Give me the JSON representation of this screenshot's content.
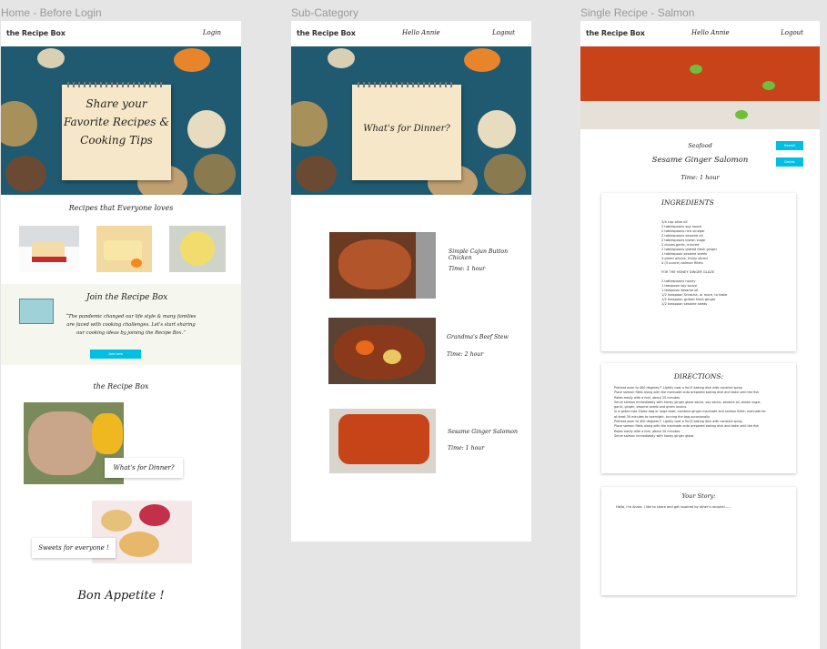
{
  "frames": {
    "home": {
      "title": "Home - Before Login"
    },
    "sub": {
      "title": "Sub-Category"
    },
    "single": {
      "title": "Single Recipe - Salmon"
    }
  },
  "home": {
    "logo": "the Recipe Box",
    "login": "Login",
    "hero_lines": [
      "Share your",
      "Favorite Recipes &",
      "Cooking Tips"
    ],
    "loved_heading": "Recipes that Everyone loves",
    "join_title": "Join the Recipe Box",
    "join_lines": [
      "“The pandemic changed our life style & many families",
      "are faced with cooking challenges.  Let's start sharing",
      "our cooking ideas by joining the Recipe Box.”"
    ],
    "join_button": "Join here",
    "recipe_box_heading": "the Recipe Box",
    "dinner_label": "What's for Dinner?",
    "sweets_label": "Sweets for everyone !",
    "closing": "Bon Appetite !"
  },
  "sub": {
    "logo": "the Recipe Box",
    "greeting": "Hello Annie",
    "logout": "Logout",
    "hero_text": "What's for Dinner?",
    "recipes": [
      {
        "name": "Simple Cajun Button Chicken",
        "time": "Time: 1 hour"
      },
      {
        "name": "Grandma's Beef Stew",
        "time": "Time: 2 hour"
      },
      {
        "name": "Sesame Ginger Salomon",
        "time": "Time: 1 hour"
      }
    ]
  },
  "single": {
    "logo": "the Recipe Box",
    "greeting": "Hello Annie",
    "logout": "Logout",
    "category": "Seafood",
    "title": "Sesame Ginger Salomon",
    "time": "Time: 1 hour",
    "button_search": "Search",
    "button_delete": "Delete",
    "ingredients_heading": "INGREDIENTS",
    "ingredients": [
      "3/4 cup olive oil",
      "2 tablespoons soy sauce",
      "2 tablespoons rice vinegar",
      "2 tablespoons sesame oil",
      "2 tablespoons brown sugar",
      "2 cloves garlic, minced",
      "2 tablespoons grated fresh ginger",
      "1 tablespoon sesame seeds",
      "4 green onions, thinly sliced",
      "4 (5 ounce) salmon fillets"
    ],
    "glaze_heading": "FOR THE HONEY GINGER GLAZE",
    "glaze": [
      "2 tablespoons honey",
      "1 teaspoon soy sauce",
      "1 teaspoon sesame oil",
      "1/2 teaspoon Sriracha, or more, to taste",
      "1/2 teaspoon grated fresh ginger",
      "1/2 teaspoon sesame seeds"
    ],
    "directions_heading": "DIRECTIONS:",
    "directions": [
      "Preheat oven to 400 degrees F. Lightly coat a 9x13 baking dish with nonstick spray.",
      "Place salmon filets along with the marinade onto prepared baking dish and bake until the fish",
      "flakes easily with a fork, about 20 minutes.",
      "Serve salmon immediately with honey ginger glaze sauce, soy sauce, sesame oil, brown sugar,",
      "garlic, ginger, sesame seeds and green onions.",
      "In a gallon size Ziploc bag or large bowl, combine ginger marinade and salmon filets; marinate for",
      "at least 30 minutes to overnight, turning the bag occasionally.",
      "Preheat oven to 400 degrees F. Lightly coat a 9x13 baking dish with nonstick spray.",
      "Place salmon filets along with the marinade onto prepared baking dish and bake until the fish",
      "flakes easily with a fork, about 20 minutes.",
      "Serve salmon immediately with honey ginger glaze."
    ],
    "story_heading": "Your Story:",
    "story_text": "Hello, I'm Annie.  I like to share and get inspired by other's recipes!......"
  },
  "colors": {
    "accent": "#00bfe3",
    "hero_bg": "#1f5a70",
    "join_bg": "#f5f7ee"
  }
}
